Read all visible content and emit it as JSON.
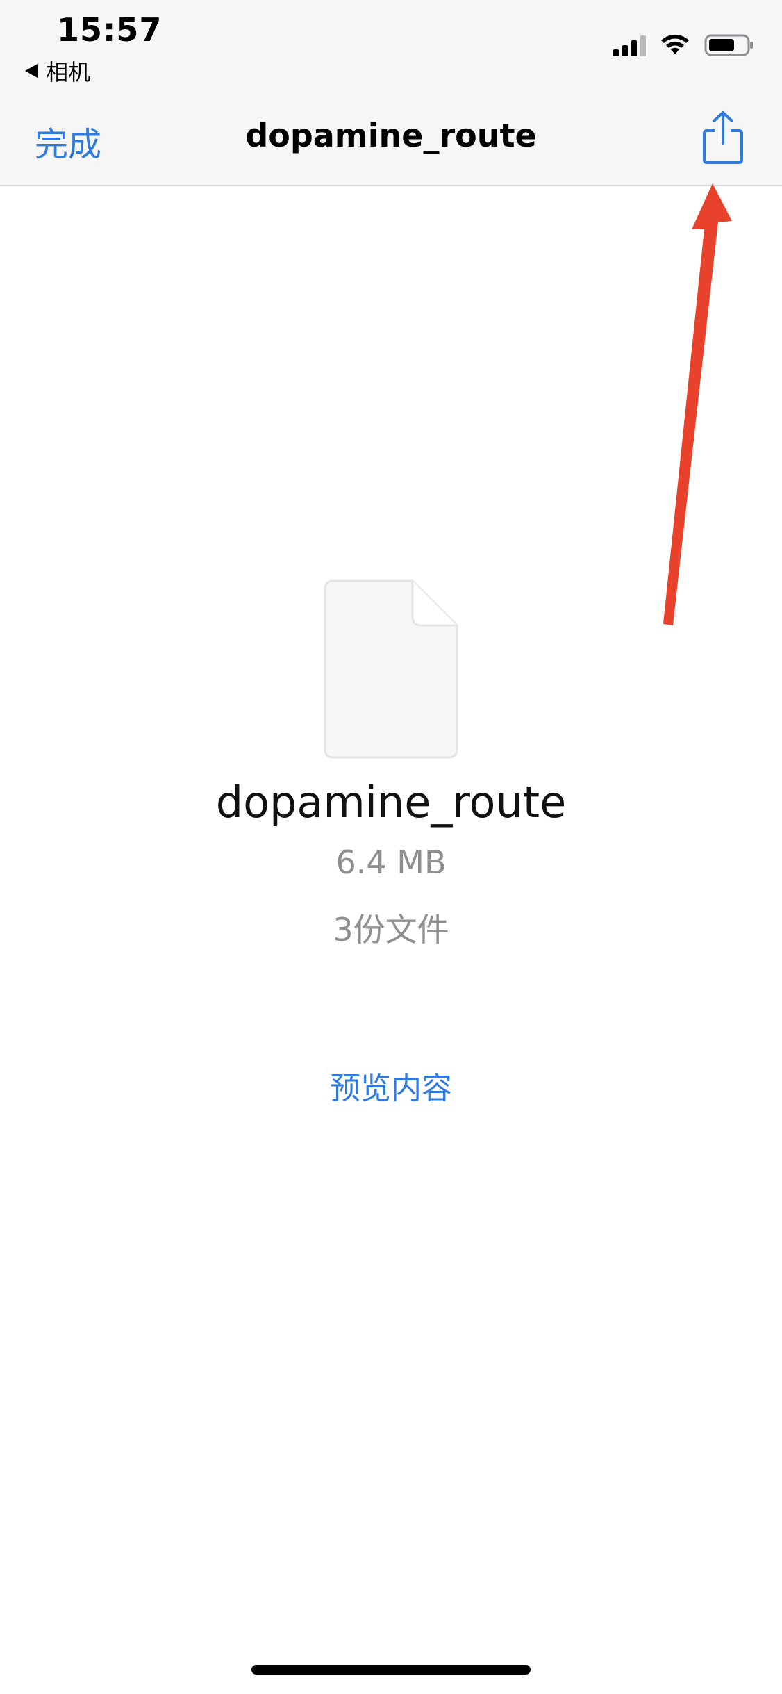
{
  "status_bar": {
    "time": "15:57",
    "back_app": "相机",
    "icons": [
      "cellular-signal-icon",
      "wifi-icon",
      "battery-icon"
    ]
  },
  "nav": {
    "done_label": "完成",
    "title": "dopamine_route",
    "share_icon": "share-icon"
  },
  "file": {
    "name": "dopamine_route",
    "size": "6.4 MB",
    "count": "3份文件",
    "icon": "document-icon"
  },
  "actions": {
    "preview_label": "预览内容"
  },
  "colors": {
    "accent": "#2f7bdd",
    "annotation": "#e8412c",
    "secondary_text": "#8e8e93",
    "header_bg": "#f6f6f6"
  }
}
